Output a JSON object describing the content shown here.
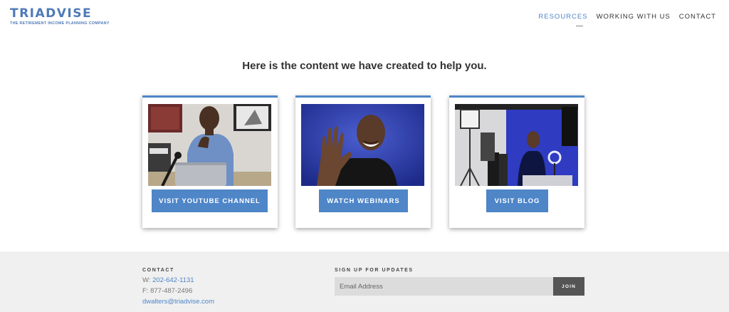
{
  "header": {
    "logo_text": "TRIADVISE",
    "logo_tagline": "THE RETIREMENT INCOME PLANNING COMPANY",
    "nav": [
      {
        "label": "RESOURCES",
        "active": true
      },
      {
        "label": "WORKING WITH US",
        "active": false
      },
      {
        "label": "CONTACT",
        "active": false
      }
    ]
  },
  "main": {
    "headline": "Here is the content we have created to help you.",
    "cards": [
      {
        "button": "VISIT YOUTUBE CHANNEL",
        "image": "man-at-laptop-photo"
      },
      {
        "button": "WATCH WEBINARS",
        "image": "man-waving-photo"
      },
      {
        "button": "VISIT BLOG",
        "image": "studio-setup-photo"
      }
    ]
  },
  "footer": {
    "contact_label": "CONTACT",
    "w_prefix": "W: ",
    "w_phone": "202-642-1131",
    "f_line": "F: 877-487-2496",
    "email": "dwalters@triadvise.com",
    "signup_label": "SIGN UP FOR UPDATES",
    "email_placeholder": "Email Address",
    "join_label": "JOIN"
  },
  "colors": {
    "accent": "#4e86c8",
    "logo": "#4e7ab8",
    "footer_bg": "#f0f0f0",
    "join_bg": "#555555"
  }
}
